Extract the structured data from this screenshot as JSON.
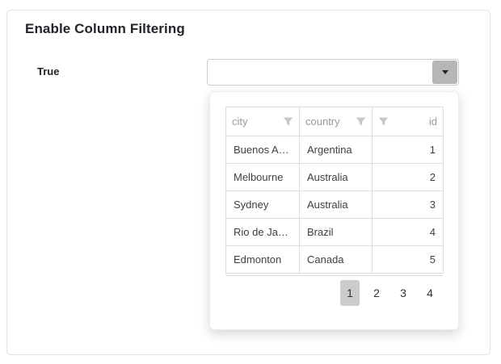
{
  "card": {
    "title": "Enable Column Filtering"
  },
  "form": {
    "label": "True",
    "combobox": {
      "value": "",
      "placeholder": ""
    }
  },
  "icons": {
    "dropdown_button": "caret-down-icon",
    "column_filter": "filter-funnel-icon"
  },
  "colors": {
    "dropdown_button_bg": "#b6b6b6",
    "active_page_bg": "#cccccc",
    "header_text": "#9a9a9a",
    "cell_text": "#3f3f3f",
    "grid_border": "#dddddd"
  },
  "grid": {
    "columns": [
      {
        "label": "city",
        "align": "left"
      },
      {
        "label": "country",
        "align": "left"
      },
      {
        "label": "id",
        "align": "right"
      }
    ],
    "rows": [
      [
        "Buenos A…",
        "Argentina",
        "1"
      ],
      [
        "Melbourne",
        "Australia",
        "2"
      ],
      [
        "Sydney",
        "Australia",
        "3"
      ],
      [
        "Rio de Ja…",
        "Brazil",
        "4"
      ],
      [
        "Edmonton",
        "Canada",
        "5"
      ]
    ]
  },
  "pagination": {
    "pages": [
      "1",
      "2",
      "3",
      "4"
    ],
    "active": "1"
  }
}
